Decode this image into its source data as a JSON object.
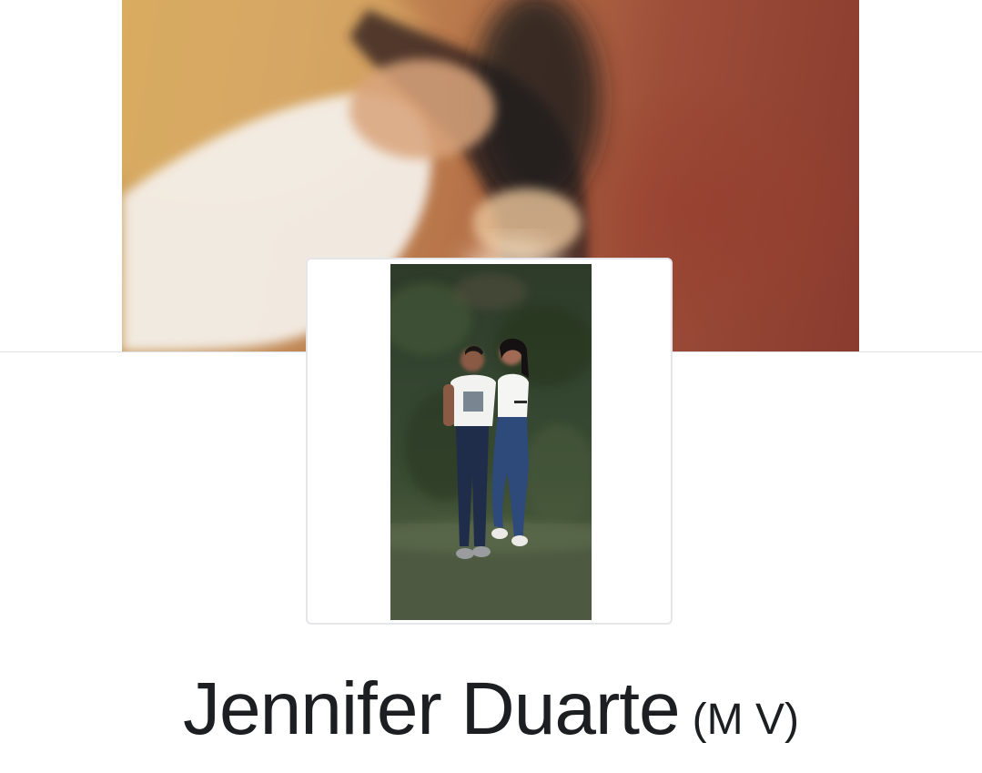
{
  "profile": {
    "name": "Jennifer Duarte",
    "alternate_name": "(M V)"
  },
  "colors": {
    "page_background": "#ffffff",
    "divider": "#dddfe2",
    "name_text": "#1c1e21"
  }
}
